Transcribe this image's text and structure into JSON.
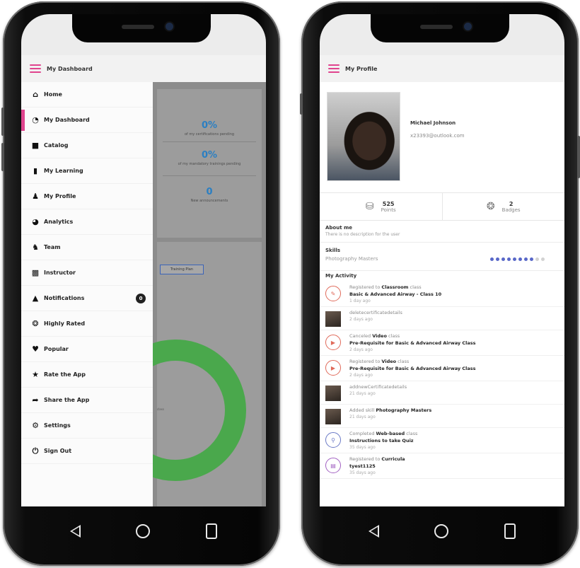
{
  "left_phone": {
    "title": "My Dashboard",
    "dashboard": {
      "stats": [
        {
          "value": "0%",
          "label": "of my certifications pending"
        },
        {
          "value": "0%",
          "label": "of my mandatory trainings pending"
        },
        {
          "value": "0",
          "label": "New announcements"
        }
      ],
      "plan_button": "Training Plan",
      "chart_label": "class"
    },
    "drawer": {
      "items": [
        {
          "label": "Home",
          "icon": "home-icon"
        },
        {
          "label": "My Dashboard",
          "icon": "dashboard-icon"
        },
        {
          "label": "Catalog",
          "icon": "folder-icon"
        },
        {
          "label": "My Learning",
          "icon": "book-icon"
        },
        {
          "label": "My Profile",
          "icon": "person-icon"
        },
        {
          "label": "Analytics",
          "icon": "pie-chart-icon"
        },
        {
          "label": "Team",
          "icon": "team-icon"
        },
        {
          "label": "Instructor",
          "icon": "instructor-icon"
        },
        {
          "label": "Notifications",
          "icon": "bell-icon",
          "badge": "0"
        },
        {
          "label": "Highly Rated",
          "icon": "award-icon"
        },
        {
          "label": "Popular",
          "icon": "heart-icon"
        },
        {
          "label": "Rate the App",
          "icon": "star-icon"
        },
        {
          "label": "Share the App",
          "icon": "share-icon"
        },
        {
          "label": "Settings",
          "icon": "gear-icon"
        },
        {
          "label": "Sign Out",
          "icon": "power-icon"
        }
      ],
      "active_index": 1
    }
  },
  "right_phone": {
    "title": "My Profile",
    "user": {
      "name": "Michael Johnson",
      "email": "x23393@outlook.com"
    },
    "stats": {
      "points_value": "525",
      "points_label": "Points",
      "badges_value": "2",
      "badges_label": "Badges"
    },
    "about": {
      "title": "About me",
      "text": "There is no description for the user"
    },
    "skills": {
      "title": "Skills",
      "name": "Photography Masters",
      "level": 8,
      "max": 10
    },
    "activity": {
      "title": "My Activity",
      "items": [
        {
          "icon": "classroom-icon",
          "prefix": "Registered to",
          "kind": "Classroom",
          "suffix": "class",
          "detail": "Basic & Advanced Airway - Class 10",
          "time": "1 day ago"
        },
        {
          "icon": "photo-thumb",
          "prefix": "deletecertificatedetails",
          "kind": "",
          "suffix": "",
          "detail": "",
          "time": "2 days ago"
        },
        {
          "icon": "video-icon",
          "prefix": "Canceled",
          "kind": "Video",
          "suffix": "class",
          "detail": "Pre-Requisite for Basic & Advanced Airway Class",
          "time": "2 days ago"
        },
        {
          "icon": "video-icon",
          "prefix": "Registered to",
          "kind": "Video",
          "suffix": "class",
          "detail": "Pre-Requisite for Basic & Advanced Airway Class",
          "time": "2 days ago"
        },
        {
          "icon": "photo-thumb",
          "prefix": "addnewCertificatedetails",
          "kind": "",
          "suffix": "",
          "detail": "",
          "time": "21 days ago"
        },
        {
          "icon": "photo-thumb",
          "prefix": "Added skill",
          "kind": "Photography Masters",
          "suffix": "",
          "detail": "",
          "time": "21 days ago"
        },
        {
          "icon": "web-icon",
          "prefix": "Completed",
          "kind": "Web-based",
          "suffix": "class",
          "detail": "Instructions to take Quiz",
          "time": "35 days ago"
        },
        {
          "icon": "curricula-icon",
          "prefix": "Registered to",
          "kind": "Curricula",
          "suffix": "",
          "detail": "tyest1125",
          "time": "35 days ago"
        }
      ]
    }
  },
  "colors": {
    "accent_pink": "#e0448e",
    "link_blue": "#2b7fc2",
    "chart_green": "#4aa84c",
    "skill_dot": "#5867c8"
  }
}
